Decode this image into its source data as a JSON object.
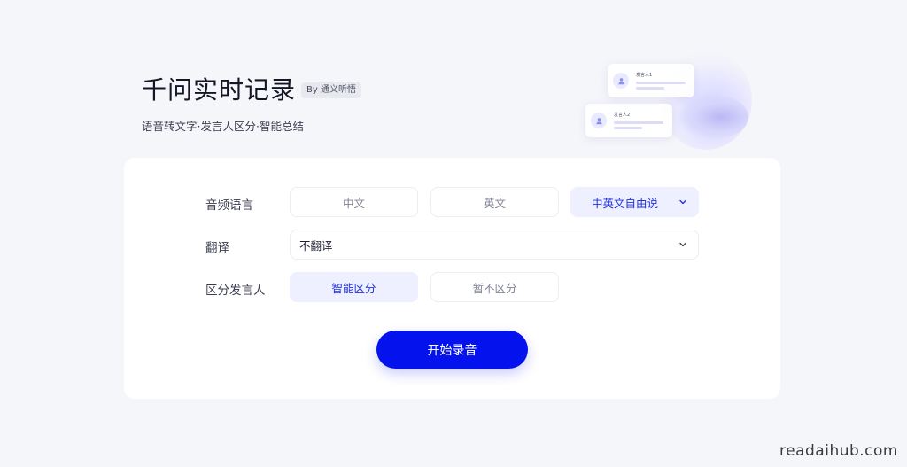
{
  "header": {
    "title": "千问实时记录",
    "badge": "By 通义听悟",
    "subtitle": "语音转文字·发言人区分·智能总结"
  },
  "illustration": {
    "speakers": [
      "发言人1",
      "发言人2"
    ]
  },
  "form": {
    "audio_language": {
      "label": "音频语言",
      "options": [
        "中文",
        "英文",
        "中英文自由说"
      ],
      "selected": "中英文自由说"
    },
    "translation": {
      "label": "翻译",
      "value": "不翻译"
    },
    "speaker_separation": {
      "label": "区分发言人",
      "options": [
        "智能区分",
        "暂不区分"
      ],
      "selected": "智能区分"
    },
    "start_button": "开始录音"
  },
  "watermark": "readaihub.com",
  "colors": {
    "accent": "#0413ee",
    "selected_bg": "#eef0ff",
    "selected_text": "#2130e0",
    "page_bg": "#f5f6fa"
  }
}
